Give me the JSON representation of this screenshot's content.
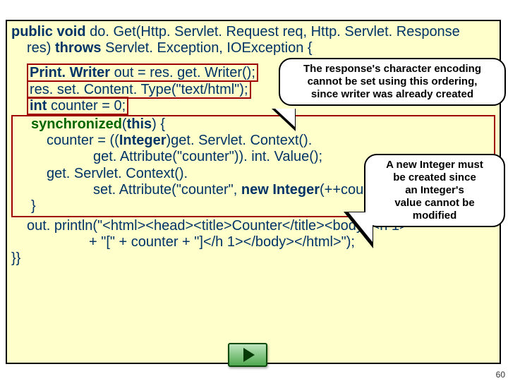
{
  "code": {
    "l1a": "public void",
    "l1b": " do. Get(Http. Servlet. Request req, Http. Servlet. Response",
    "l2a": "res) ",
    "l2b": "throws",
    "l2c": " Servlet. Exception, IOException {",
    "l3a": "Print. Writer",
    "l3b": " out = res. get. Writer();",
    "l4": "res. set. Content. Type(\"text/html\");",
    "l5a": "int",
    "l5b": " counter = 0;",
    "l6a": "synchronized",
    "l6b": "(",
    "l6c": "this",
    "l6d": ") {",
    "l7a": "counter = ((",
    "l7b": "Integer",
    "l7c": ")get. Servlet. Context().",
    "l8": "get. Attribute(\"counter\")). int. Value();",
    "l9": "get. Servlet. Context().",
    "l10a": "set. Attribute(\"counter\", ",
    "l10b": "new Integer",
    "l10c": "(++counter));",
    "l11": "}",
    "l12": "out. println(\"<html><head><title>Counter</title><body><h 1>\"",
    "l13": "+ \"[\" + counter + \"]</h 1></body></html>\");",
    "l14": "}}"
  },
  "callouts": {
    "c1_l1": "The response's character encoding",
    "c1_l2": "cannot be set using this ordering,",
    "c1_l3": "since writer was already created",
    "c2_l1": "A new Integer must",
    "c2_l2": "be created since",
    "c2_l3": "an Integer's",
    "c2_l4": "value cannot be",
    "c2_l5": "modified"
  },
  "page_number": "60"
}
